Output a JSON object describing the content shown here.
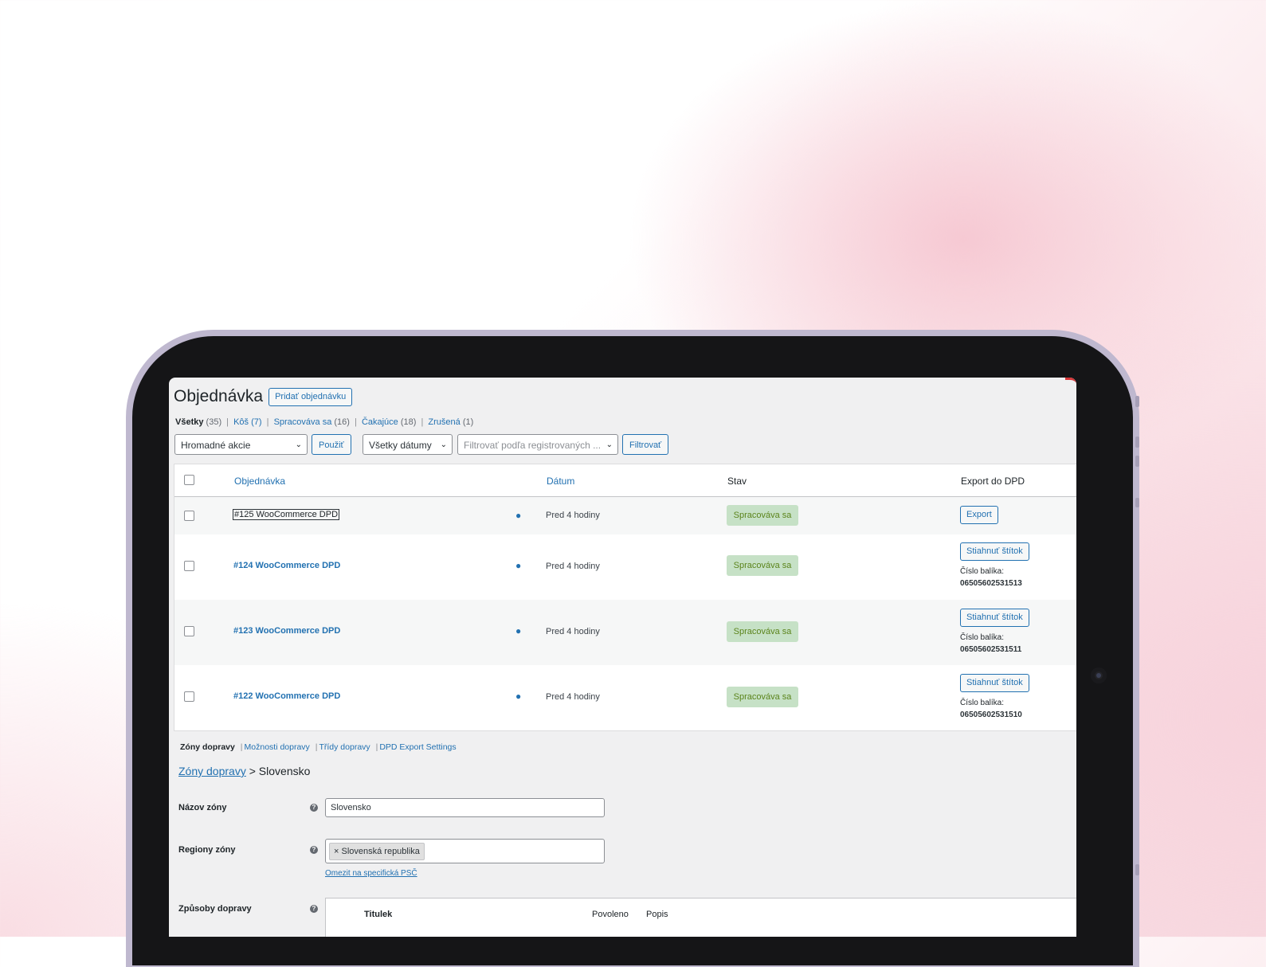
{
  "page": {
    "title": "Objednávka",
    "add_order_label": "Pridať objednávku"
  },
  "status_filters": [
    {
      "label": "Všetky",
      "count": "(35)",
      "current": true
    },
    {
      "label": "Kôš",
      "count": "(7)"
    },
    {
      "label": "Spracováva sa",
      "count": "(16)"
    },
    {
      "label": "Čakajúce",
      "count": "(18)"
    },
    {
      "label": "Zrušená",
      "count": "(1)"
    }
  ],
  "separator": "|",
  "tablenav": {
    "bulk_actions": "Hromadné akcie",
    "apply": "Použiť",
    "dates": "Všetky dátumy",
    "customer_filter_placeholder": "Filtrovať podľa registrovaných ...",
    "filter": "Filtrovať"
  },
  "orders_table": {
    "columns": {
      "order": "Objednávka",
      "date": "Dátum",
      "status": "Stav",
      "export": "Export do DPD"
    },
    "rows": [
      {
        "order": "#125 WooCommerce DPD",
        "date": "Pred 4 hodiny",
        "status": "Spracováva sa",
        "action": "Export",
        "package_label": "",
        "package_number": ""
      },
      {
        "order": "#124 WooCommerce DPD",
        "date": "Pred 4 hodiny",
        "status": "Spracováva sa",
        "action": "Stiahnuť štítok",
        "package_label": "Číslo balíka:",
        "package_number": "06505602531513"
      },
      {
        "order": "#123 WooCommerce DPD",
        "date": "Pred 4 hodiny",
        "status": "Spracováva sa",
        "action": "Stiahnuť štítok",
        "package_label": "Číslo balíka:",
        "package_number": "06505602531511"
      },
      {
        "order": "#122 WooCommerce DPD",
        "date": "Pred 4 hodiny",
        "status": "Spracováva sa",
        "action": "Stiahnuť štítok",
        "package_label": "Číslo balíka:",
        "package_number": "06505602531510"
      }
    ]
  },
  "shipping": {
    "tabs": [
      "Zóny dopravy",
      "Možnosti dopravy",
      "Třídy dopravy",
      "DPD Export Settings"
    ],
    "breadcrumb": {
      "link": "Zóny dopravy",
      "sep": ">",
      "current": "Slovensko"
    },
    "zone_name_label": "Názov zóny",
    "zone_name_value": "Slovensko",
    "zone_regions_label": "Regiony zóny",
    "region_chip": "× Slovenská republika",
    "limit_link": "Omezit na specifická PSČ",
    "methods_label": "Způsoby dopravy",
    "methods_columns": {
      "title": "Titulek",
      "enabled": "Povoleno",
      "description": "Popis"
    }
  },
  "icons": {
    "help": "?",
    "eye": "●",
    "chevron": "⌄"
  }
}
